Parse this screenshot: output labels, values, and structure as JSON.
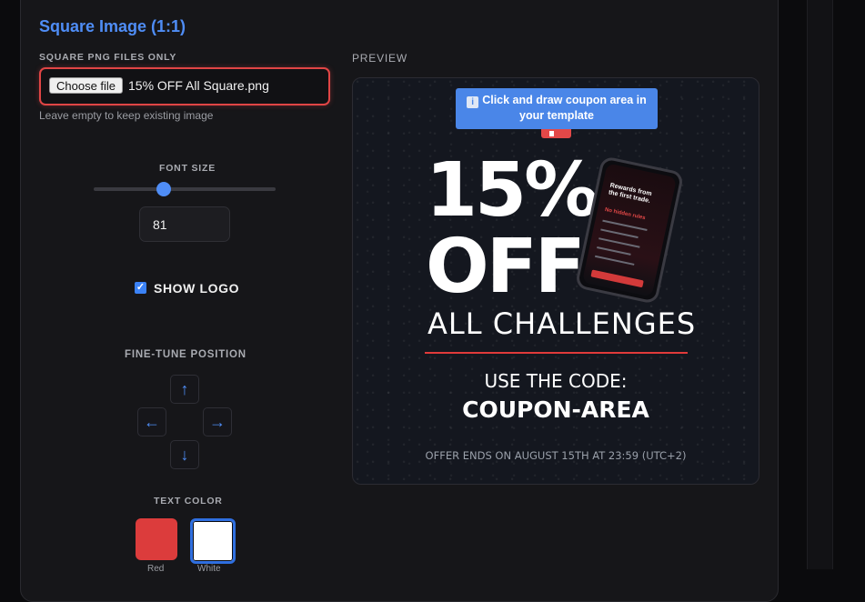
{
  "section": {
    "title": "Square Image (1:1)"
  },
  "upload": {
    "label": "SQUARE PNG FILES ONLY",
    "button_label": "Choose file",
    "file_name": "15% OFF All Square.png",
    "hint": "Leave empty to keep existing image"
  },
  "font_size": {
    "label": "FONT SIZE",
    "value": "81",
    "slider_fraction": 0.38
  },
  "show_logo": {
    "label": "SHOW LOGO",
    "checked": true
  },
  "fine_tune": {
    "label": "FINE-TUNE POSITION",
    "up": "↑",
    "left": "←",
    "right": "→",
    "down": "↓"
  },
  "text_color": {
    "label": "TEXT COLOR",
    "options": [
      {
        "name": "Red",
        "color": "#dc3c3c",
        "selected": false
      },
      {
        "name": "White",
        "color": "#ffffff",
        "selected": true
      }
    ]
  },
  "preview": {
    "label": "PREVIEW",
    "tooltip_icon": "ℹ️",
    "tooltip": "Click and draw coupon area in your template",
    "headline_pct": "15%",
    "headline_off": "OFF",
    "subheadline": "ALL CHALLENGES",
    "use_code": "USE THE CODE:",
    "coupon_area": "COUPON-AREA",
    "offer_ends": "OFFER ENDS ON AUGUST 15TH AT 23:59 (UTC+2)",
    "phone_headline": "Rewards from the first trade.",
    "phone_red": "No hidden rules"
  },
  "colors": {
    "accent": "#4f8df6",
    "danger": "#e04545"
  }
}
